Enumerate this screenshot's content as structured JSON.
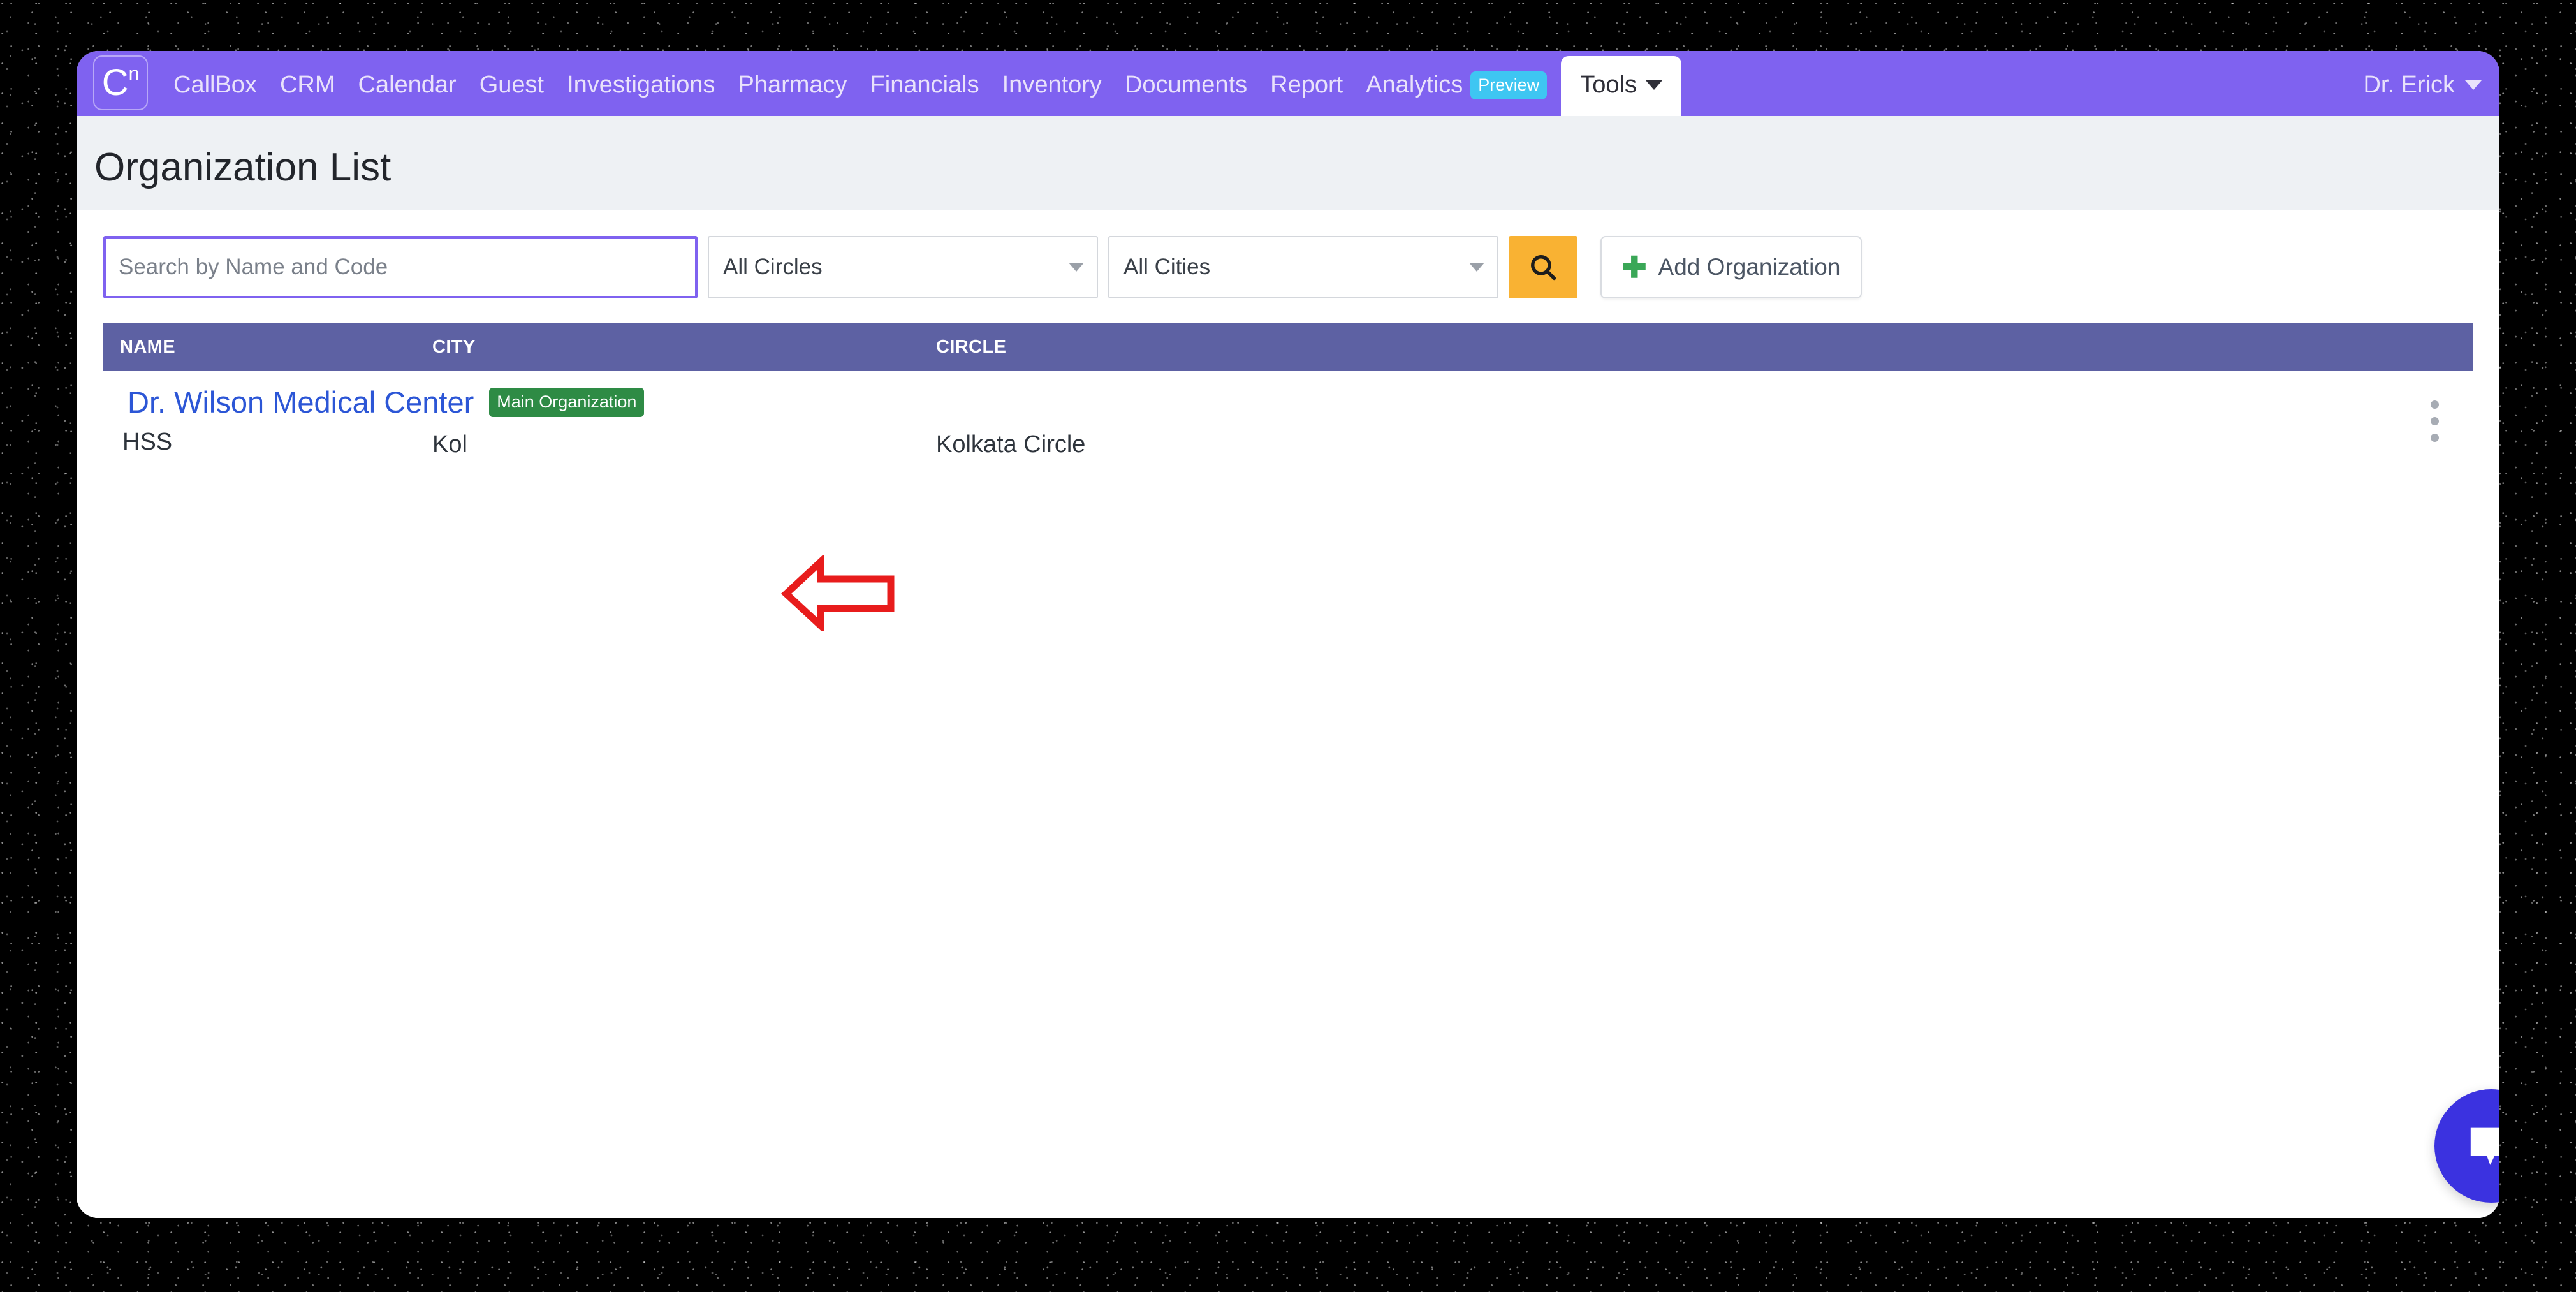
{
  "brand": {
    "logo_main": "C",
    "logo_sup": "n"
  },
  "navbar": {
    "links": [
      "CallBox",
      "CRM",
      "Calendar",
      "Guest",
      "Investigations",
      "Pharmacy",
      "Financials",
      "Inventory",
      "Documents",
      "Report",
      "Analytics"
    ],
    "preview_badge": "Preview",
    "active_tab": "Tools",
    "user": "Dr. Erick",
    "bg_color": "#7f62f0",
    "badge_color": "#3ec6f2"
  },
  "page": {
    "title": "Organization List"
  },
  "filters": {
    "search_placeholder": "Search by Name and Code",
    "search_value": "",
    "circle_select": "All Circles",
    "city_select": "All Cities",
    "search_button_icon": "search-icon",
    "add_button_label": "Add Organization",
    "add_button_icon": "plus-icon",
    "search_button_color": "#f9b233",
    "focus_border_color": "#7f62f0"
  },
  "table": {
    "header_bg": "#5d61a3",
    "columns": [
      "NAME",
      "CITY",
      "CIRCLE"
    ],
    "rows": [
      {
        "icon": "hospital-icon",
        "name": "Dr. Wilson Medical Center",
        "badge": "Main Organization",
        "badge_color": "#2e8b45",
        "code": "HSS",
        "city": "Kol",
        "circle": "Kolkata Circle",
        "menu_icon": "kebab-menu-icon"
      }
    ]
  },
  "annotation": {
    "type": "arrow-left",
    "color": "#e81c1c"
  },
  "chat": {
    "icon": "chat-bubble-icon",
    "color": "#3b32e0"
  }
}
